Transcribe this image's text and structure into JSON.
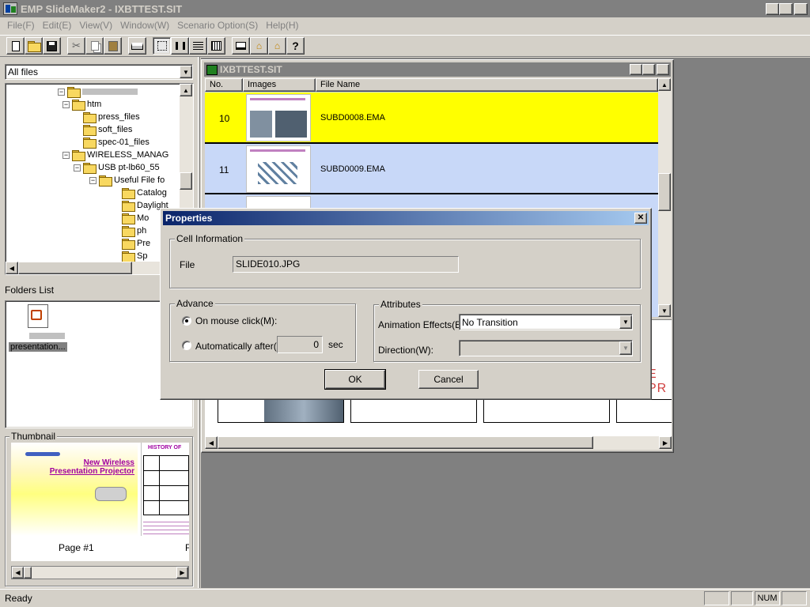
{
  "app": {
    "title": "EMP SlideMaker2 - IXBTTEST.SIT",
    "menu": [
      "File(F)",
      "Edit(E)",
      "View(V)",
      "Window(W)",
      "Scenario Option(S)",
      "Help(H)"
    ]
  },
  "left": {
    "filter": "All files",
    "tree": [
      {
        "label": "htm",
        "indent": 0
      },
      {
        "label": "press_files",
        "indent": 1
      },
      {
        "label": "soft_files",
        "indent": 1
      },
      {
        "label": "spec-01_files",
        "indent": 1
      },
      {
        "label": "WIRELESS_MANAG",
        "indent": 0
      },
      {
        "label": "USB pt-lb60_55",
        "indent": 1
      },
      {
        "label": "Useful File fo",
        "indent": 2
      },
      {
        "label": "Catalog",
        "indent": 3
      },
      {
        "label": "Daylight",
        "indent": 3
      },
      {
        "label": "Mo",
        "indent": 3
      },
      {
        "label": "ph",
        "indent": 3
      },
      {
        "label": "Pre",
        "indent": 3
      },
      {
        "label": "Sp",
        "indent": 3
      }
    ],
    "folders_list_label": "Folders List",
    "file_item_label": "presentation...",
    "thumbnail_label": "Thumbnail",
    "thumb_title_1": "New Wireless",
    "thumb_title_2": "Presentation Projector",
    "thumb_history": "HISTORY OF",
    "page_label": "Page #1",
    "page_label_2": "F"
  },
  "doc": {
    "title": "IXBTTEST.SIT",
    "headers": [
      "No.",
      "Images",
      "File Name"
    ],
    "rows": [
      {
        "no": "10",
        "file": "SUBD0008.EMA",
        "selected": true
      },
      {
        "no": "11",
        "file": "SUBD0009.EMA",
        "selected": false
      }
    ],
    "preview_text": "E PR"
  },
  "dialog": {
    "title": "Properties",
    "cell_info_label": "Cell Information",
    "file_label": "File",
    "file_value": "SLIDE010.JPG",
    "advance_label": "Advance",
    "radio_mouse": "On mouse click(M):",
    "radio_auto": "Automatically after(A):",
    "seconds_value": "0",
    "sec_unit": "sec",
    "attributes_label": "Attributes",
    "anim_label": "Animation Effects(E):",
    "anim_value": "No Transition",
    "direction_label": "Direction(W):",
    "direction_value": "",
    "ok": "OK",
    "cancel": "Cancel"
  },
  "status": {
    "text": "Ready",
    "num": "NUM"
  },
  "colors": {
    "selected_row": "#ffff00",
    "normal_row": "#c8d8f8",
    "mdi_bg": "#808080"
  }
}
